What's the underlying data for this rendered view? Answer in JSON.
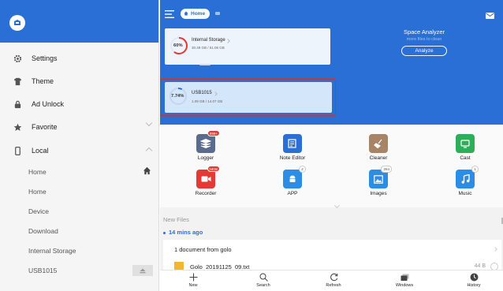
{
  "drawer": {
    "items": [
      {
        "label": "Settings",
        "icon": "gear-icon"
      },
      {
        "label": "Theme",
        "icon": "shirt-icon"
      },
      {
        "label": "Ad Unlock",
        "icon": "lock-icon"
      },
      {
        "label": "Favorite",
        "icon": "star-icon"
      },
      {
        "label": "Local",
        "icon": "phone-icon"
      }
    ],
    "local_items": [
      "Home",
      "Home",
      "Device",
      "Download",
      "Internal Storage",
      "USB1015"
    ]
  },
  "header": {
    "home_chip": "Home"
  },
  "storage": {
    "internal": {
      "percent": "60%",
      "name": "Internal Storage",
      "usage": "30.49 GB / 51.06 GB",
      "fraction": 0.6
    },
    "usb": {
      "percent": "7.74%",
      "name": "USB1015",
      "usage": "1.09 GB / 14.07 GB",
      "fraction": 0.0774
    }
  },
  "analyzer": {
    "title": "Space Analyzer",
    "subtitle": "more files to clean",
    "button": "Analyze"
  },
  "tiles": [
    {
      "label": "Logger",
      "badge": "999+",
      "color": "#5b6b8c"
    },
    {
      "label": "Note Editor",
      "badge": "",
      "color": "#2a6fd6"
    },
    {
      "label": "Cleaner",
      "badge": "",
      "color": "#a88466"
    },
    {
      "label": "Cast",
      "badge": "",
      "color": "#2fae5a"
    },
    {
      "label": "Recorder",
      "badge": "NEW",
      "color": "#e53935"
    },
    {
      "label": "APP",
      "badge": "2",
      "color": "#2a8ee6"
    },
    {
      "label": "Images",
      "badge": "264",
      "color": "#2a8ee6"
    },
    {
      "label": "Music",
      "badge": "1",
      "color": "#2a8ee6"
    }
  ],
  "new_files": {
    "header": "New Files",
    "time": "14 mins ago",
    "group": "1 document from golo",
    "file_name": "Golo_20191125_09.txt",
    "file_size": "44 B"
  },
  "bottom": [
    "New",
    "Search",
    "Refresh",
    "Windows",
    "History"
  ],
  "colors": {
    "accent": "#2a6fd6",
    "selection": "#d32f2f"
  }
}
